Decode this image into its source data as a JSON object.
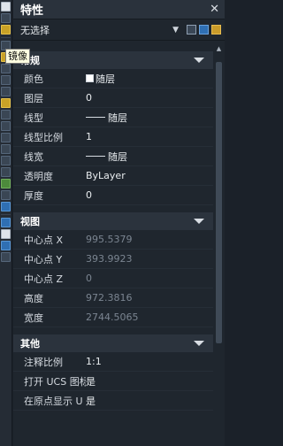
{
  "tooltip": "镜像",
  "palette": {
    "title": "特性",
    "close_glyph": "✕",
    "selection": "无选择"
  },
  "sections": {
    "general": {
      "title": "常规",
      "rows": [
        {
          "label": "颜色",
          "value": "随层"
        },
        {
          "label": "图层",
          "value": "0"
        },
        {
          "label": "线型",
          "value": "随层"
        },
        {
          "label": "线型比例",
          "value": "1"
        },
        {
          "label": "线宽",
          "value": "随层"
        },
        {
          "label": "透明度",
          "value": "ByLayer"
        },
        {
          "label": "厚度",
          "value": "0"
        }
      ]
    },
    "view": {
      "title": "视图",
      "rows": [
        {
          "label": "中心点 X",
          "value": "995.5379"
        },
        {
          "label": "中心点 Y",
          "value": "393.9923"
        },
        {
          "label": "中心点 Z",
          "value": "0"
        },
        {
          "label": "高度",
          "value": "972.3816"
        },
        {
          "label": "宽度",
          "value": "2744.5065"
        }
      ]
    },
    "misc": {
      "title": "其他",
      "rows": [
        {
          "label": "注释比例",
          "value": "1:1"
        },
        {
          "label": "打开 UCS 图标",
          "value": "是"
        },
        {
          "label": "在原点显示 U",
          "value": "是"
        }
      ]
    }
  },
  "colors": {
    "accent": "#2f6fb3",
    "panel_bg": "#1f262e",
    "header_bg": "#2b333d"
  }
}
